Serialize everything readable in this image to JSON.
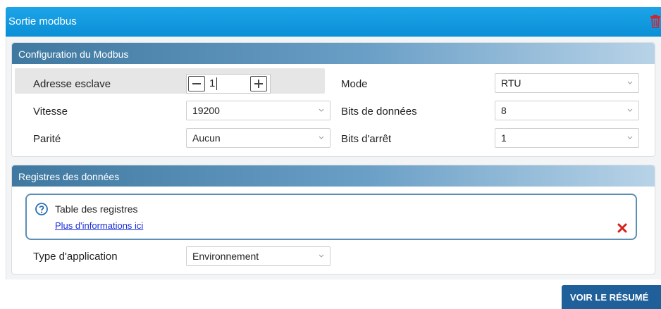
{
  "header": {
    "title": "Sortie modbus",
    "delete_icon": "trash-icon",
    "accent": "#1da4e8"
  },
  "config": {
    "title": "Configuration du Modbus",
    "address": {
      "label": "Adresse esclave",
      "value": "1"
    },
    "speed": {
      "label": "Vitesse",
      "value": "19200"
    },
    "parity": {
      "label": "Parité",
      "value": "Aucun"
    },
    "mode": {
      "label": "Mode",
      "value": "RTU"
    },
    "data_bits": {
      "label": "Bits de données",
      "value": "8"
    },
    "stop_bits": {
      "label": "Bits d'arrêt",
      "value": "1"
    }
  },
  "registers": {
    "title": "Registres des données",
    "info_title": "Table des registres",
    "info_link": "Plus d'informations ici",
    "app_type": {
      "label": "Type d'application",
      "value": "Environnement"
    }
  },
  "footer": {
    "summary_button": "VOIR LE RÉSUMÉ"
  }
}
